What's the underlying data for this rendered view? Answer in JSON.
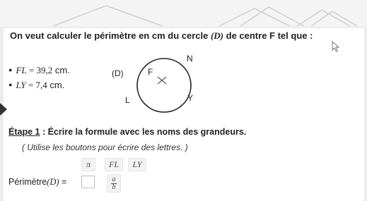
{
  "question": {
    "text_before": "On veut calculer le périmètre en cm du cercle ",
    "circle_name": "(D)",
    "text_after": " de centre F tel que :"
  },
  "givens": [
    {
      "label": "FL",
      "eq": " = ",
      "value": "39,2",
      "unit": " cm."
    },
    {
      "label": "LY",
      "eq": " = ",
      "value": "7,4",
      "unit": " cm."
    }
  ],
  "figure": {
    "circle_label": "(D)",
    "center_label": "F",
    "points": {
      "top": "N",
      "left": "L",
      "right": "Y"
    }
  },
  "step": {
    "title_prefix": "Étape 1",
    "title_rest": " : Écrire la formule avec les noms des grandeurs.",
    "hint": "( Utilise les boutons pour écrire des lettres. )"
  },
  "keyboard": {
    "pi": "π",
    "fl": "FL",
    "ly": "LY",
    "frac_num": "a",
    "frac_den": "b"
  },
  "answer": {
    "prefix": "Périmètre",
    "var": "(D)",
    "eq": " = ",
    "value": ""
  },
  "colors": {
    "background": "#ececec",
    "card": "#ffffff",
    "button": "#f3f3f3"
  }
}
